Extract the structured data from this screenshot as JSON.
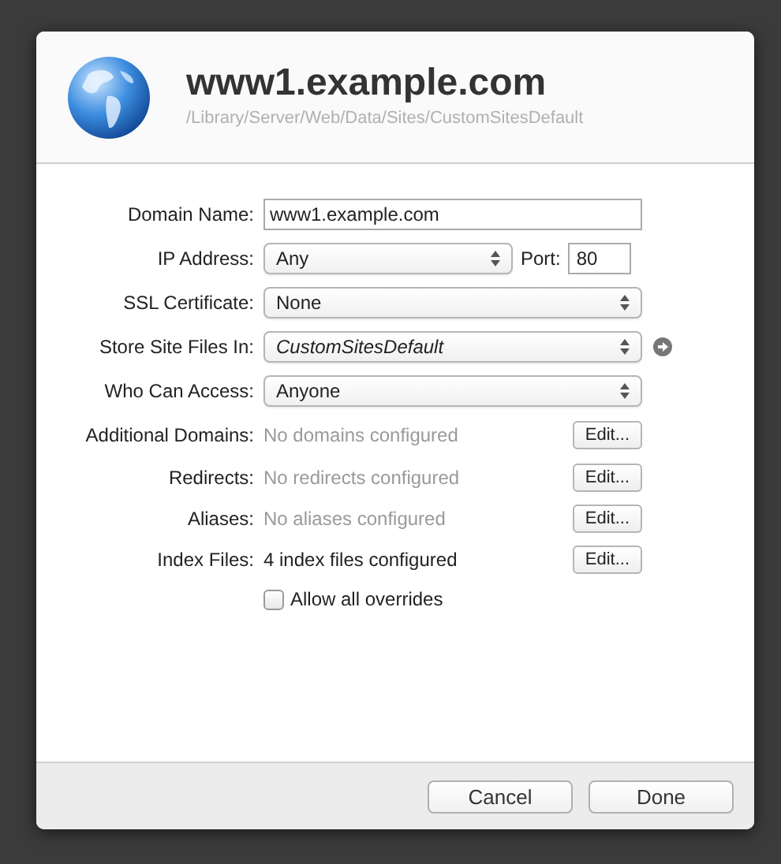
{
  "header": {
    "title": "www1.example.com",
    "path": "/Library/Server/Web/Data/Sites/CustomSitesDefault"
  },
  "rows": [
    {
      "kind": "text",
      "label": "Domain Name:",
      "value": "www1.example.com"
    },
    {
      "kind": "popup_port",
      "label": "IP Address:",
      "value": "Any",
      "port_label": "Port:",
      "port": "80"
    },
    {
      "kind": "popup",
      "label": "SSL Certificate:",
      "value": "None"
    },
    {
      "kind": "popup_go",
      "label": "Store Site Files In:",
      "value": "CustomSitesDefault"
    },
    {
      "kind": "popup",
      "label": "Who Can Access:",
      "value": "Anyone"
    },
    {
      "kind": "summary",
      "label": "Additional Domains:",
      "value": "No domains configured",
      "disabled": true,
      "button": "Edit..."
    },
    {
      "kind": "summary",
      "label": "Redirects:",
      "value": "No redirects configured",
      "disabled": true,
      "button": "Edit..."
    },
    {
      "kind": "summary",
      "label": "Aliases:",
      "value": "No aliases configured",
      "disabled": true,
      "button": "Edit..."
    },
    {
      "kind": "summary",
      "label": "Index Files:",
      "value": "4 index files configured",
      "disabled": false,
      "button": "Edit..."
    },
    {
      "kind": "checkbox",
      "label": "Allow all overrides",
      "checked": false
    }
  ],
  "buttons": [
    "Cancel",
    "Done"
  ]
}
